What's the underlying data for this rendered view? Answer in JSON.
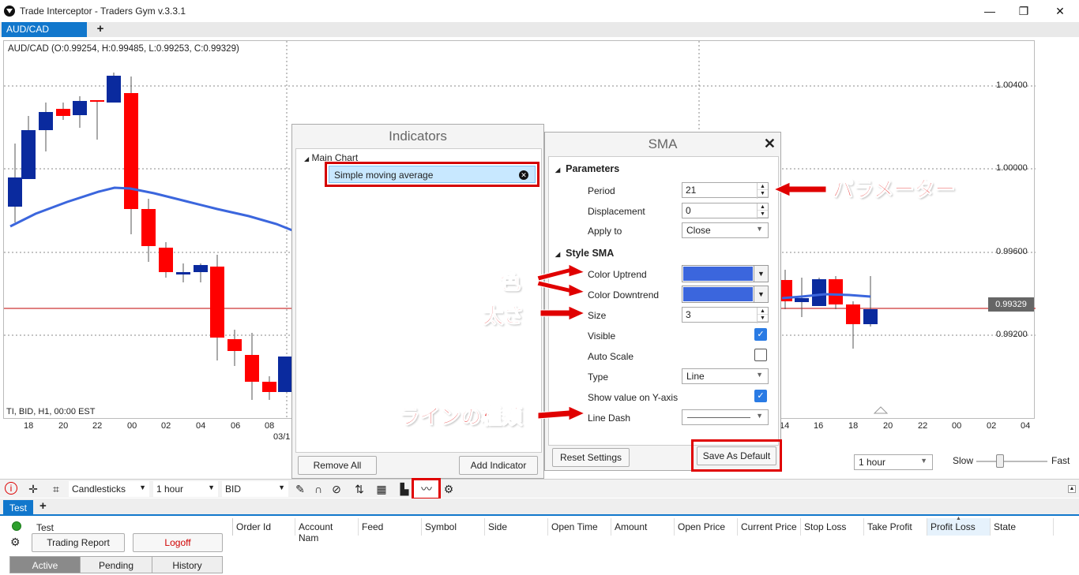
{
  "window": {
    "title": "Trade Interceptor - Traders Gym v.3.3.1",
    "min": "—",
    "max": "❐",
    "close": "✕"
  },
  "chart_tabs": {
    "active": "AUD/CAD",
    "add": "+"
  },
  "chart": {
    "ohlc_label": "AUD/CAD (O:0.99254, H:0.99485, L:0.99253, C:0.99329)",
    "info": "TI, BID, H1, 00:00 EST",
    "y_ticks": [
      "1.00400",
      "1.00000",
      "0.99600",
      "0.99200"
    ],
    "current_price": "0.99329",
    "x_ticks_left": [
      "18",
      "20",
      "22",
      "00",
      "02",
      "04",
      "06",
      "08"
    ],
    "x_date": "03/1",
    "x_ticks_right": [
      "14",
      "16",
      "18",
      "20",
      "22",
      "00",
      "02",
      "04"
    ],
    "colors": {
      "up": "#0a2a9e",
      "down": "#ff0000",
      "sma": "#3b66dd",
      "price_line": "#c00000"
    }
  },
  "indicators": {
    "title": "Indicators",
    "group": "Main Chart",
    "item": "Simple moving average",
    "remove_all": "Remove All",
    "add": "Add Indicator"
  },
  "sma": {
    "title": "SMA",
    "parameters": "Parameters",
    "period_label": "Period",
    "period": "21",
    "displacement_label": "Displacement",
    "displacement": "0",
    "apply_label": "Apply to",
    "apply": "Close",
    "style": "Style SMA",
    "up_label": "Color Uptrend",
    "down_label": "Color Downtrend",
    "size_label": "Size",
    "size": "3",
    "visible_label": "Visible",
    "autoscale_label": "Auto Scale",
    "type_label": "Type",
    "type": "Line",
    "showy_label": "Show value on Y-axis",
    "dash_label": "Line Dash",
    "reset": "Reset Settings",
    "save": "Save As Default"
  },
  "annotations": {
    "params": "パラメーター",
    "color": "色",
    "size": "太さ",
    "linetype": "ラインの種類"
  },
  "speed": {
    "timeframe": "1 hour",
    "slow": "Slow",
    "fast": "Fast"
  },
  "toolbar": {
    "chart_type": "Candlesticks",
    "timeframe": "1 hour",
    "price": "BID"
  },
  "bottom": {
    "tab": "Test",
    "add": "+",
    "account": "Test",
    "trading_report": "Trading Report",
    "logoff": "Logoff",
    "segments": [
      "Active",
      "Pending",
      "History"
    ],
    "columns": [
      "Order Id",
      "Account Nam",
      "Feed",
      "Symbol",
      "Side",
      "Open Time",
      "Amount",
      "Open Price",
      "Current Price",
      "Stop Loss",
      "Take Profit",
      "Profit Loss",
      "State"
    ]
  }
}
